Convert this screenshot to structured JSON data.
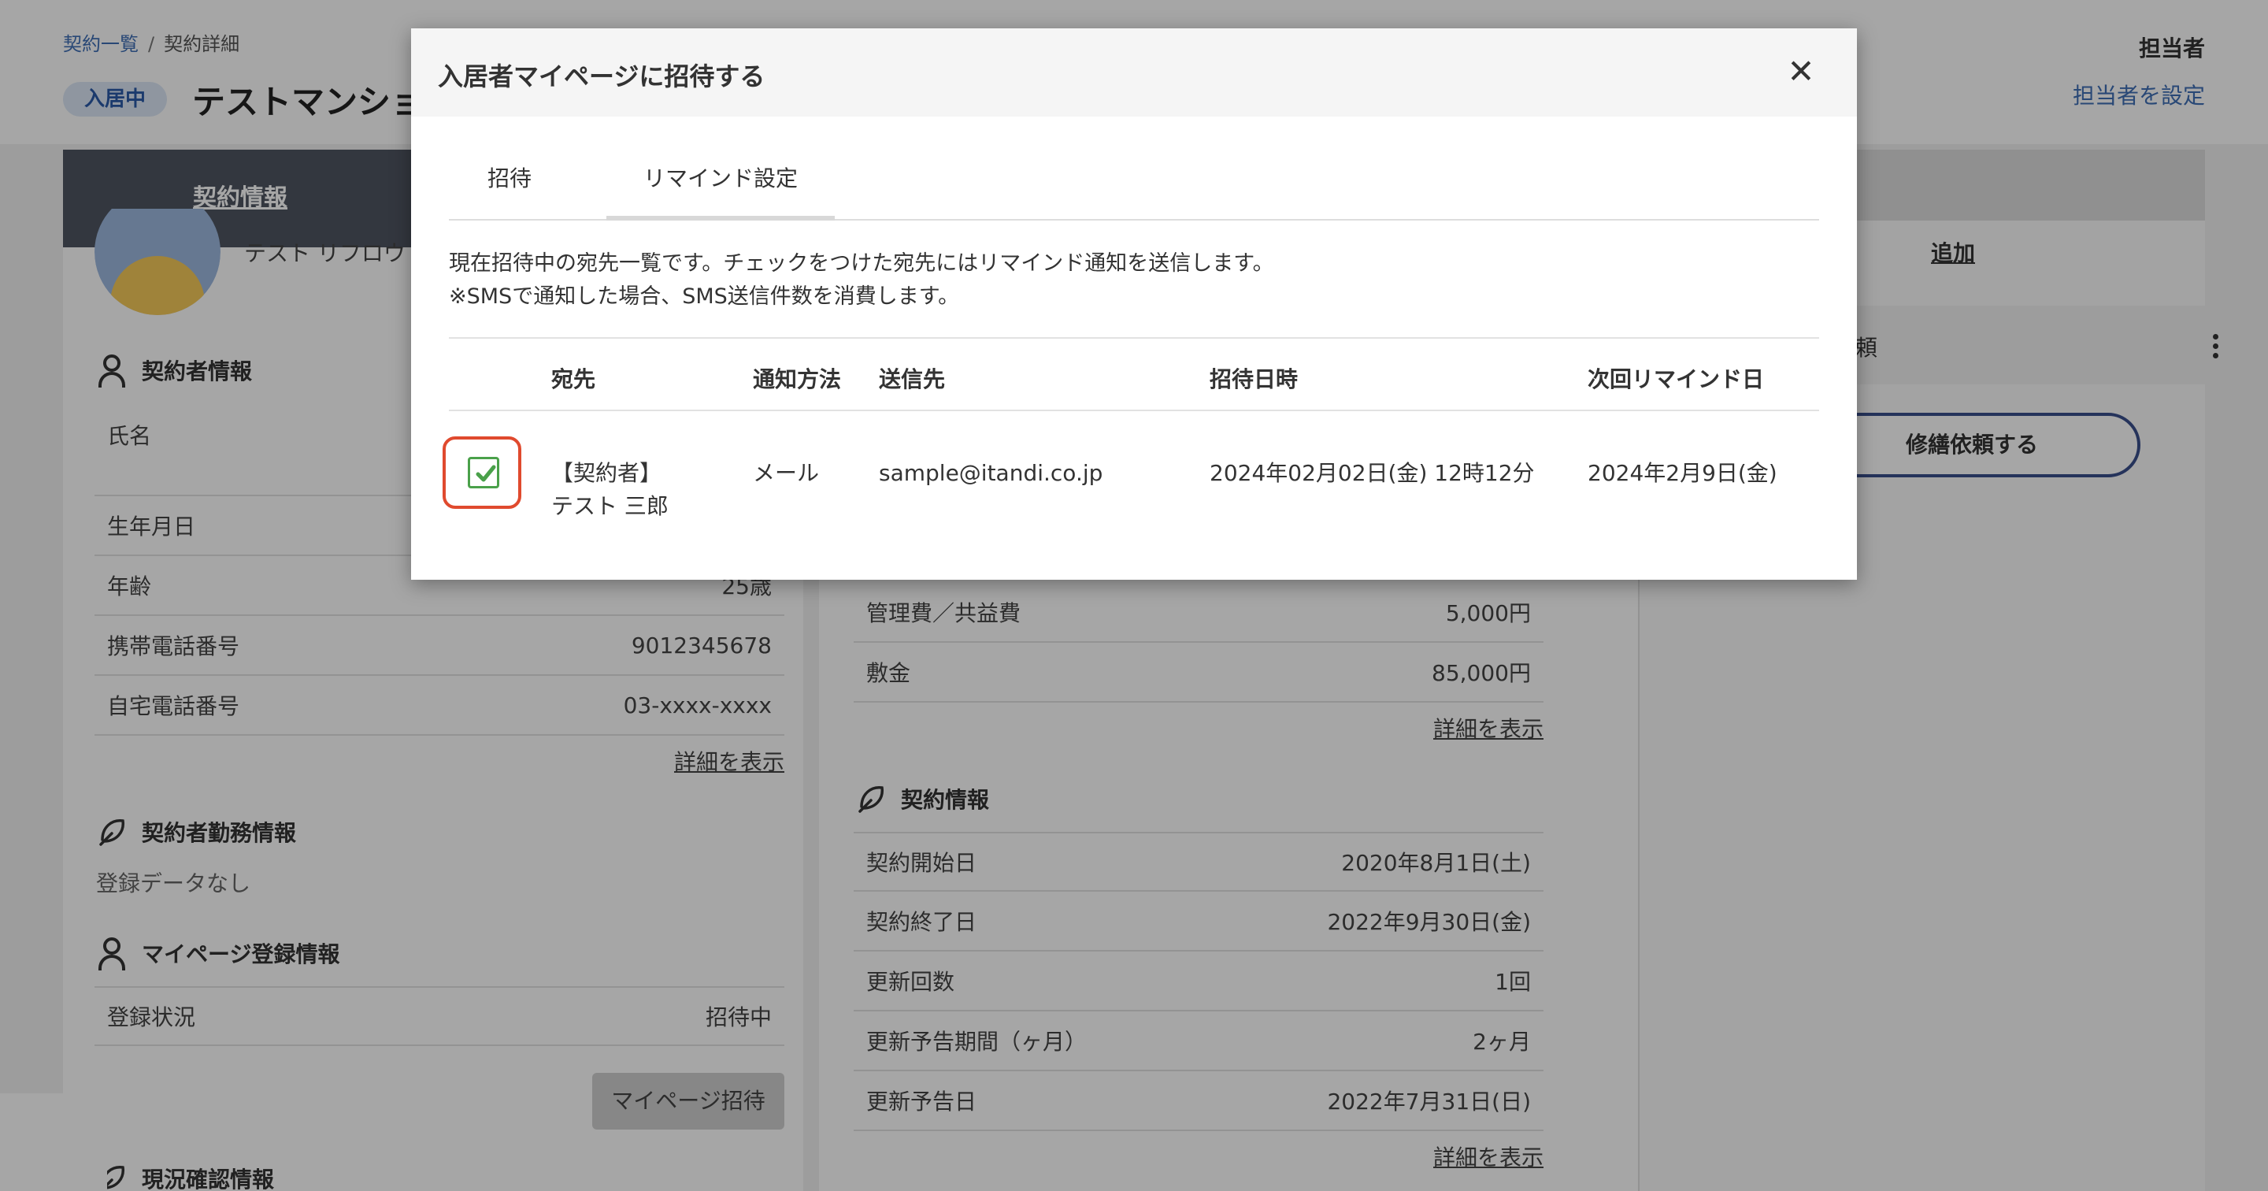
{
  "breadcrumb": {
    "list": "契約一覧",
    "separator": "/",
    "current": "契約詳細"
  },
  "header": {
    "status": "入居中",
    "title": "テストマンション",
    "assignee_heading": "担当者",
    "assignee_link": "担当者を設定"
  },
  "main_tab": {
    "label": "契約情報"
  },
  "tenant": {
    "name": "テスト リフロウ"
  },
  "contractor_section": {
    "title": "契約者情報",
    "rows": [
      {
        "k": "氏名",
        "v": ""
      },
      {
        "k": "生年月日",
        "v": ""
      },
      {
        "k": "年齢",
        "v": "25歳"
      },
      {
        "k": "携帯電話番号",
        "v": "9012345678"
      },
      {
        "k": "自宅電話番号",
        "v": "03-xxxx-xxxx"
      }
    ],
    "detail_link": "詳細を表示"
  },
  "work_section": {
    "title": "契約者勤務情報",
    "empty": "登録データなし"
  },
  "mypage_section": {
    "title": "マイページ登録情報",
    "status_k": "登録状況",
    "status_v": "招待中",
    "invite_button": "マイページ招待"
  },
  "current_section": {
    "title": "現況確認情報"
  },
  "fees": {
    "rows": [
      {
        "k": "管理費／共益費",
        "v": "5,000円"
      },
      {
        "k": "敷金",
        "v": "85,000円"
      }
    ],
    "detail_link": "詳細を表示"
  },
  "contract_info": {
    "title": "契約情報",
    "rows": [
      {
        "k": "契約開始日",
        "v": "2020年8月1日(土)"
      },
      {
        "k": "契約終了日",
        "v": "2022年9月30日(金)"
      },
      {
        "k": "更新回数",
        "v": "1回"
      },
      {
        "k": "更新予告期間（ヶ月）",
        "v": "2ヶ月"
      },
      {
        "k": "更新予告日",
        "v": "2022年7月31日(日)"
      }
    ],
    "detail_link": "詳細を表示"
  },
  "right_panel": {
    "add_link": "追加",
    "request_label": "頼",
    "repair_button": "修繕依頼する"
  },
  "modal": {
    "title": "入居者マイページに招待する",
    "close": "✕",
    "tabs": [
      "招待",
      "リマインド設定"
    ],
    "desc_line1": "現在招待中の宛先一覧です。チェックをつけた宛先にはリマインド通知を送信します。",
    "desc_line2": "※SMSで通知した場合、SMS送信件数を消費します。",
    "columns": [
      "宛先",
      "通知方法",
      "送信先",
      "招待日時",
      "次回リマインド日"
    ],
    "row": {
      "checked": true,
      "recipient_line1": "【契約者】",
      "recipient_line2": "テスト 三郎",
      "method": "メール",
      "destination": "sample@itandi.co.jp",
      "invited_at": "2024年02月02日(金) 12時12分",
      "next_remind": "2024年2月9日(金)"
    }
  },
  "colors": {
    "accent_blue": "#3f6fb6",
    "check_green": "#4aa14a",
    "focus_red": "#e04a2e",
    "dark_tab": "#4f5562"
  }
}
